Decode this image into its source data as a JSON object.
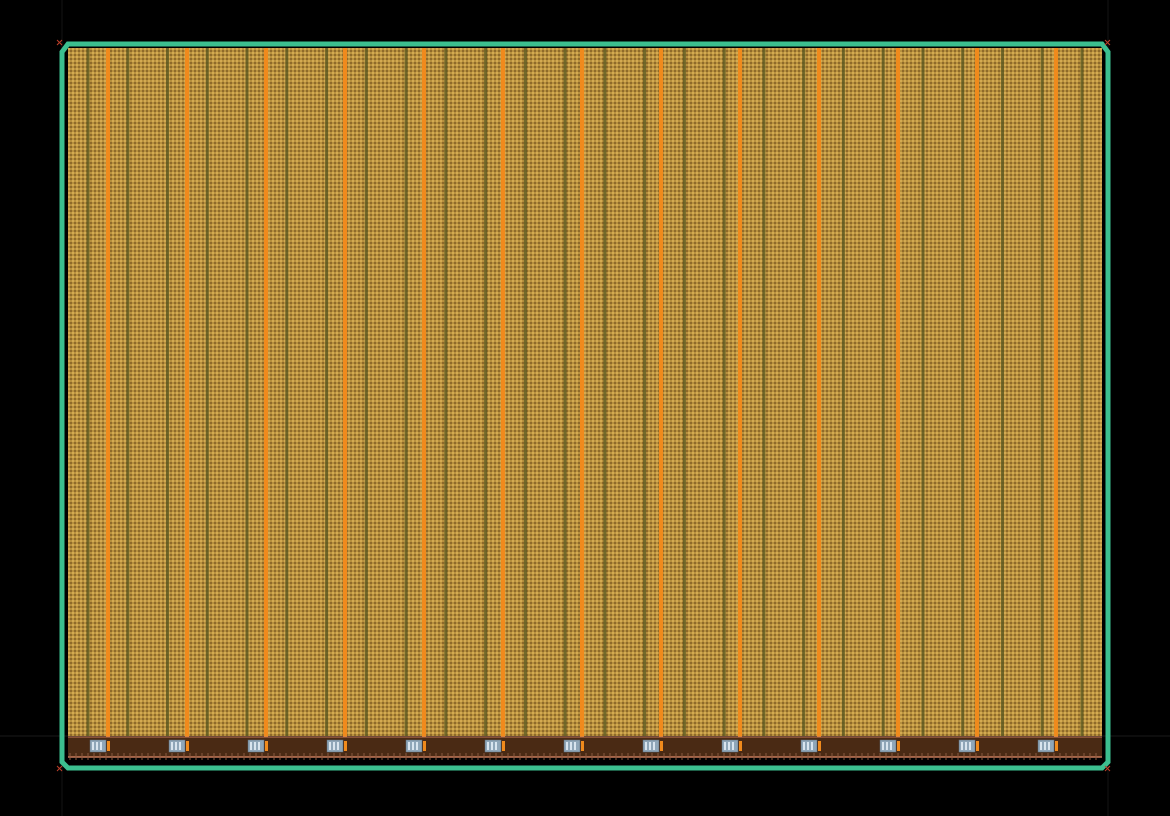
{
  "canvas": {
    "background_color": "#000000",
    "guide_line_color": "#1a1a1a"
  },
  "die": {
    "boundary_color": "#3cbf8f",
    "core_fill_color": "#b8913e",
    "cell_pattern_light": "#d4aa52",
    "cell_pattern_dark": "#8f6a2a"
  },
  "layers": {
    "power_stripe_color": "#f08a1c",
    "dark_column_color": "#5c5a22",
    "io_row_color": "#4a2a14",
    "io_rail_color": "#c87a5a",
    "macro_color": "#8fa6b8",
    "macro_pin_color": "#f08a1c",
    "corner_marker_color": "#c0402a"
  },
  "counts": {
    "power_stripes": 13,
    "dark_columns": 26,
    "io_macros": 13
  }
}
